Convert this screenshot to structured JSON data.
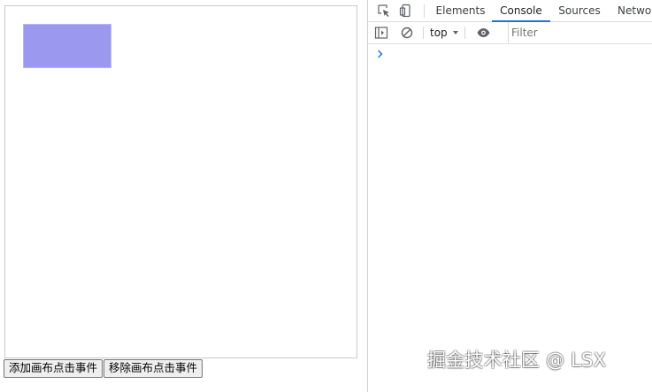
{
  "page": {
    "buttons": {
      "add_click": "添加画布点击事件",
      "remove_click": "移除画布点击事件"
    },
    "canvas": {
      "rect_color": "#9a98ef",
      "border_color": "#c9c9c9"
    }
  },
  "devtools": {
    "tabs": [
      {
        "label": "Elements"
      },
      {
        "label": "Console"
      },
      {
        "label": "Sources"
      },
      {
        "label": "Network"
      }
    ],
    "active_tab": "Console",
    "toolbar": {
      "context": "top",
      "filter_placeholder": "Filter"
    },
    "icons": {
      "inspect": "inspect-element-icon",
      "device": "device-toolbar-icon",
      "sidebar": "show-console-sidebar-icon",
      "clear": "clear-console-icon",
      "dropdown": "dropdown-triangle-icon",
      "eye": "live-expression-eye-icon",
      "prompt": "console-prompt-chevron-icon"
    },
    "colors": {
      "active_tab_underline": "#1a73e8",
      "prompt": "#1a73e8",
      "icon": "#5f6368"
    }
  },
  "watermark": {
    "text": "掘金技术社区 @ LSX"
  }
}
